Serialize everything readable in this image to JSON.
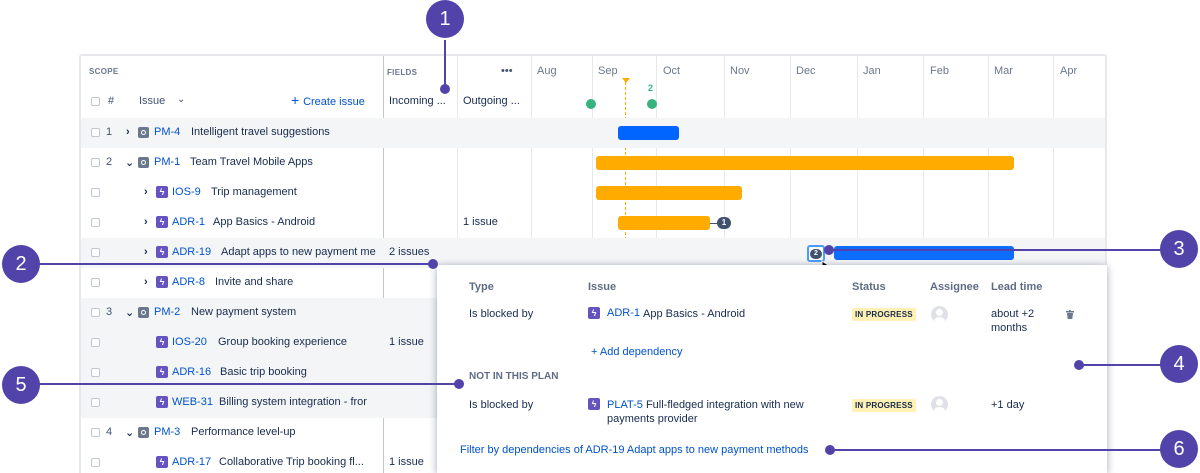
{
  "scope_header": "SCOPE",
  "fields_header": "FIELDS",
  "columns": {
    "num": "#",
    "issue": "Issue",
    "create": "Create issue",
    "incoming": "Incoming ...",
    "outgoing": "Outgoing ...",
    "more": "•••"
  },
  "months": [
    "Aug",
    "Sep",
    "Oct",
    "Nov",
    "Dec",
    "Jan",
    "Feb",
    "Mar",
    "Apr"
  ],
  "marker_count": "2",
  "rows": [
    {
      "num": "1",
      "key": "PM-4",
      "title": "Intelligent travel suggestions",
      "type": "initiative",
      "incoming": "",
      "outgoing": ""
    },
    {
      "num": "2",
      "key": "PM-1",
      "title": "Team Travel Mobile Apps",
      "type": "initiative",
      "incoming": "",
      "outgoing": ""
    },
    {
      "num": "",
      "key": "IOS-9",
      "title": "Trip management",
      "type": "epic",
      "incoming": "",
      "outgoing": ""
    },
    {
      "num": "",
      "key": "ADR-1",
      "title": "App Basics - Android",
      "type": "epic",
      "incoming": "",
      "outgoing": "1 issue"
    },
    {
      "num": "",
      "key": "ADR-19",
      "title": "Adapt apps to new payment me",
      "type": "epic",
      "incoming": "2 issues",
      "outgoing": ""
    },
    {
      "num": "",
      "key": "ADR-8",
      "title": "Invite and share",
      "type": "epic",
      "incoming": "",
      "outgoing": ""
    },
    {
      "num": "3",
      "key": "PM-2",
      "title": "New payment system",
      "type": "initiative",
      "incoming": "",
      "outgoing": ""
    },
    {
      "num": "",
      "key": "IOS-20",
      "title": "Group booking experience",
      "type": "epic",
      "incoming": "1 issue",
      "outgoing": ""
    },
    {
      "num": "",
      "key": "ADR-16",
      "title": "Basic trip booking",
      "type": "epic",
      "incoming": "",
      "outgoing": ""
    },
    {
      "num": "",
      "key": "WEB-31",
      "title": "Billing system integration - fror",
      "type": "epic",
      "incoming": "",
      "outgoing": ""
    },
    {
      "num": "4",
      "key": "PM-3",
      "title": "Performance level-up",
      "type": "initiative",
      "incoming": "",
      "outgoing": ""
    },
    {
      "num": "",
      "key": "ADR-17",
      "title": "Collaborative Trip booking fl...",
      "type": "epic",
      "incoming": "1 issue",
      "outgoing": ""
    }
  ],
  "badges": {
    "adr1_dep": "1",
    "adr19_dep": "2"
  },
  "popup": {
    "headers": {
      "type": "Type",
      "issue": "Issue",
      "status": "Status",
      "assignee": "Assignee",
      "lead": "Lead time"
    },
    "dep1": {
      "type": "Is blocked by",
      "key": "ADR-1",
      "title": "App Basics - Android",
      "status": "IN PROGRESS",
      "lead": "about +2 months"
    },
    "add_dependency": "+ Add dependency",
    "not_in_plan": "NOT IN THIS PLAN",
    "dep2": {
      "type": "Is blocked by",
      "key": "PLAT-5",
      "title": "Full-fledged integration with new payments provider",
      "status": "IN PROGRESS",
      "lead": "+1 day"
    },
    "filter_link": "Filter by dependencies of ADR-19 Adapt apps to new payment methods"
  },
  "callouts": [
    "1",
    "2",
    "3",
    "4",
    "5",
    "6"
  ],
  "colors": {
    "accent": "#5243aa",
    "link": "#0052cc",
    "bar_orange": "#ffab00",
    "bar_blue": "#0065ff",
    "milestone": "#36b37e",
    "lozenge": "#fff0b3"
  }
}
